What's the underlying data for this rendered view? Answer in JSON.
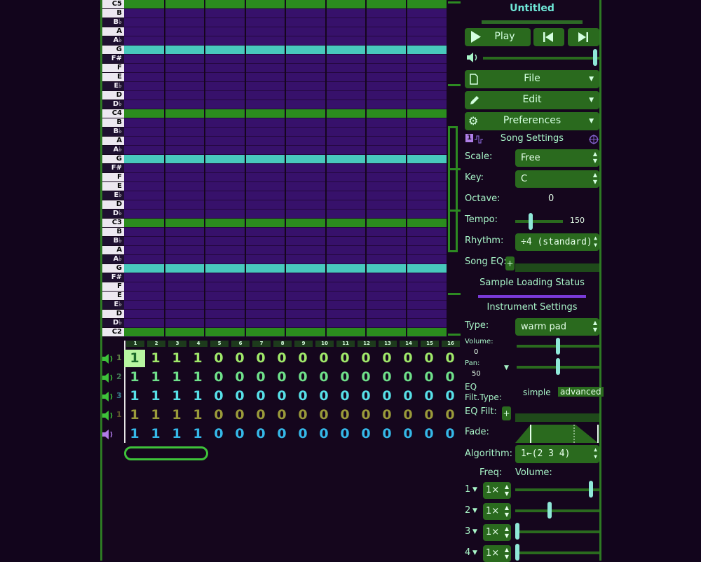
{
  "song_title": "Untitled",
  "piano_keys": [
    {
      "label": "C5",
      "black": false
    },
    {
      "label": "B",
      "black": false
    },
    {
      "label": "B♭",
      "black": true
    },
    {
      "label": "A",
      "black": false
    },
    {
      "label": "A♭",
      "black": true
    },
    {
      "label": "G",
      "black": false
    },
    {
      "label": "F#",
      "black": true
    },
    {
      "label": "F",
      "black": false
    },
    {
      "label": "E",
      "black": false
    },
    {
      "label": "E♭",
      "black": true
    },
    {
      "label": "D",
      "black": false
    },
    {
      "label": "D♭",
      "black": true
    },
    {
      "label": "C4",
      "black": false
    },
    {
      "label": "B",
      "black": false
    },
    {
      "label": "B♭",
      "black": true
    },
    {
      "label": "A",
      "black": false
    },
    {
      "label": "A♭",
      "black": true
    },
    {
      "label": "G",
      "black": false
    },
    {
      "label": "F#",
      "black": true
    },
    {
      "label": "F",
      "black": false
    },
    {
      "label": "E",
      "black": false
    },
    {
      "label": "E♭",
      "black": true
    },
    {
      "label": "D",
      "black": false
    },
    {
      "label": "D♭",
      "black": true
    },
    {
      "label": "C3",
      "black": false
    },
    {
      "label": "B",
      "black": false
    },
    {
      "label": "B♭",
      "black": true
    },
    {
      "label": "A",
      "black": false
    },
    {
      "label": "A♭",
      "black": true
    },
    {
      "label": "G",
      "black": false
    },
    {
      "label": "F#",
      "black": true
    },
    {
      "label": "F",
      "black": false
    },
    {
      "label": "E",
      "black": false
    },
    {
      "label": "E♭",
      "black": true
    },
    {
      "label": "D",
      "black": false
    },
    {
      "label": "D♭",
      "black": true
    },
    {
      "label": "C2",
      "black": false
    }
  ],
  "bar_numbers": [
    "1",
    "2",
    "3",
    "4",
    "5",
    "6",
    "7",
    "8",
    "9",
    "10",
    "11",
    "12",
    "13",
    "14",
    "15",
    "16"
  ],
  "channels": [
    {
      "num": "1",
      "color": "#a0e86a",
      "cells": [
        "1",
        "1",
        "1",
        "1",
        "0",
        "0",
        "0",
        "0",
        "0",
        "0",
        "0",
        "0",
        "0",
        "0",
        "0",
        "0"
      ],
      "selected": 0
    },
    {
      "num": "2",
      "color": "#6fe08a",
      "cells": [
        "1",
        "1",
        "1",
        "1",
        "0",
        "0",
        "0",
        "0",
        "0",
        "0",
        "0",
        "0",
        "0",
        "0",
        "0",
        "0"
      ],
      "selected": -1
    },
    {
      "num": "3",
      "color": "#57e0e8",
      "cells": [
        "1",
        "1",
        "1",
        "1",
        "0",
        "0",
        "0",
        "0",
        "0",
        "0",
        "0",
        "0",
        "0",
        "0",
        "0",
        "0"
      ],
      "selected": -1
    },
    {
      "num": "1",
      "color": "#9a9a3a",
      "cells": [
        "1",
        "1",
        "1",
        "1",
        "0",
        "0",
        "0",
        "0",
        "0",
        "0",
        "0",
        "0",
        "0",
        "0",
        "0",
        "0"
      ],
      "selected": -1
    },
    {
      "num": "",
      "color": "#35b8e8",
      "cells": [
        "1",
        "1",
        "1",
        "1",
        "0",
        "0",
        "0",
        "0",
        "0",
        "0",
        "0",
        "0",
        "0",
        "0",
        "0",
        "0"
      ],
      "selected": -1
    }
  ],
  "transport": {
    "play_label": "Play"
  },
  "volume_level": 0.98,
  "menus": {
    "file": "File",
    "edit": "Edit",
    "preferences": "Preferences"
  },
  "song_settings": {
    "badge": "1",
    "header": "Song Settings",
    "scale_label": "Scale:",
    "scale_value": "Free",
    "key_label": "Key:",
    "key_value": "C",
    "octave_label": "Octave:",
    "octave_value": "0",
    "tempo_label": "Tempo:",
    "tempo_value": "150",
    "tempo_level": 0.3,
    "rhythm_label": "Rhythm:",
    "rhythm_value": "÷4 (standard)",
    "eq_label": "Song EQ:"
  },
  "sample_status": "Sample Loading Status",
  "instrument": {
    "header": "Instrument Settings",
    "type_label": "Type:",
    "type_value": "warm pad",
    "volume_label": "Volume:",
    "volume_value": "0",
    "volume_level": 0.5,
    "pan_label": "Pan:",
    "pan_value": "50",
    "pan_level": 0.5,
    "eq_filt_type_label": "EQ Filt.Type:",
    "filt_simple": "simple",
    "filt_advanced": "advanced",
    "eq_filt_label": "EQ Filt:",
    "fade_label": "Fade:",
    "algorithm_label": "Algorithm:",
    "algorithm_value": "1←(2 3 4)",
    "freq_header": "Freq:",
    "vol_header": "Volume:",
    "operators": [
      {
        "num": "1",
        "freq": "1×",
        "level": 0.92
      },
      {
        "num": "2",
        "freq": "1×",
        "level": 0.4
      },
      {
        "num": "3",
        "freq": "1×",
        "level": 0.0
      },
      {
        "num": "4",
        "freq": "1×",
        "level": 0.0
      }
    ]
  },
  "colors": {
    "accent_green": "#2a6a1e",
    "teal": "#48c9bd",
    "purple": "#37116b"
  }
}
